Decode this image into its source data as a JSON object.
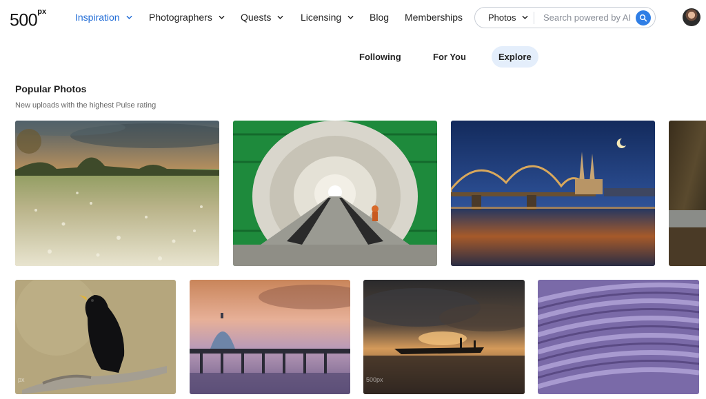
{
  "brand": {
    "logo_main": "500",
    "logo_sup": "px"
  },
  "nav": {
    "inspiration": "Inspiration",
    "photographers": "Photographers",
    "quests": "Quests",
    "licensing": "Licensing",
    "blog": "Blog",
    "memberships": "Memberships"
  },
  "search": {
    "type": "Photos",
    "placeholder": "Search powered by AI"
  },
  "feed_tabs": {
    "following": "Following",
    "for_you": "For You",
    "explore": "Explore",
    "selected": "Explore"
  },
  "section": {
    "title": "Popular Photos",
    "subtitle": "New uploads with the highest Pulse rating"
  },
  "photos": {
    "bird_watermark": "px",
    "boat_watermark": "500px"
  },
  "colors": {
    "accent": "#1f6bd6",
    "search_button": "#2f7ee5",
    "tab_selected_bg": "#e4eefb"
  }
}
